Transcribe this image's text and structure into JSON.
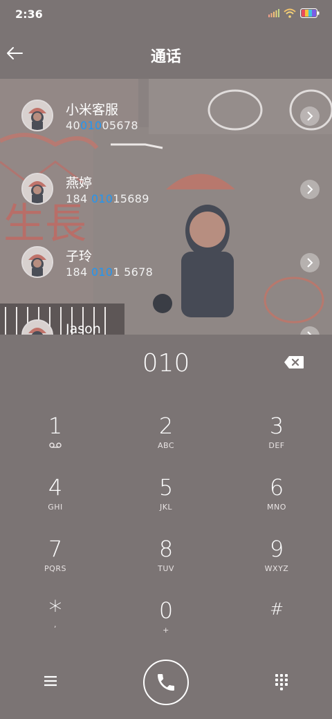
{
  "status_bar": {
    "time": "2:36"
  },
  "header": {
    "title": "通话"
  },
  "contacts": [
    {
      "name": "小米客服",
      "number_pre": "40",
      "number_match": "010",
      "number_post": "05678"
    },
    {
      "name": "燕婷",
      "number_pre": "184 ",
      "number_match": "010",
      "number_post": "15689"
    },
    {
      "name": "子玲",
      "number_pre": "184 ",
      "number_match": "010",
      "number_post": "1 5678"
    },
    {
      "name": "Jason",
      "number_pre": "",
      "number_match": "",
      "number_post": ""
    }
  ],
  "dialer": {
    "input": "010",
    "keys": [
      {
        "digit": "1",
        "letters": ""
      },
      {
        "digit": "2",
        "letters": "ABC"
      },
      {
        "digit": "3",
        "letters": "DEF"
      },
      {
        "digit": "4",
        "letters": "GHI"
      },
      {
        "digit": "5",
        "letters": "JKL"
      },
      {
        "digit": "6",
        "letters": "MNO"
      },
      {
        "digit": "7",
        "letters": "PQRS"
      },
      {
        "digit": "8",
        "letters": "TUV"
      },
      {
        "digit": "9",
        "letters": "WXYZ"
      },
      {
        "digit": "*",
        "letters": ","
      },
      {
        "digit": "0",
        "letters": "+"
      },
      {
        "digit": "#",
        "letters": ""
      }
    ]
  },
  "colors": {
    "background": "#7b7474",
    "highlight": "#2196f3"
  },
  "icons": [
    "back-arrow-icon",
    "backspace-icon",
    "voicemail-icon",
    "menu-icon",
    "phone-icon",
    "keypad-icon",
    "chevron-right-icon"
  ]
}
